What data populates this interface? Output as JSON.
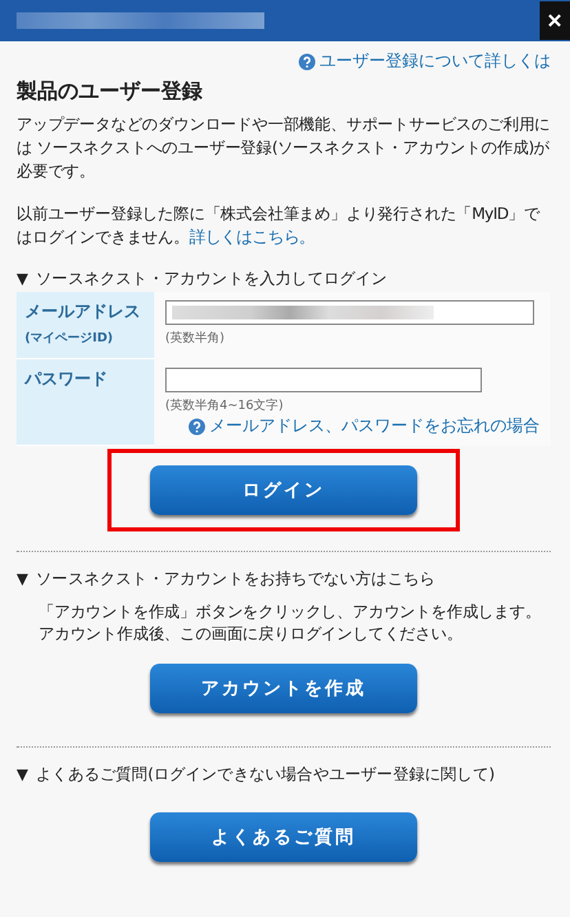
{
  "window": {
    "title_redacted": true,
    "close": "✕"
  },
  "help_link": "ユーザー登録について詳しくは",
  "heading": "製品のユーザー登録",
  "intro": "アップデータなどのダウンロードや一部機能、サポートサービスのご利用には ソースネクストへのユーザー登録(ソースネクスト・アカウントの作成)が必要です。",
  "notice": {
    "text": "以前ユーザー登録した際に「株式会社筆まめ」より発行された「MyID」ではログインできません。",
    "link": "詳しくはこちら。"
  },
  "login_section": {
    "marker": "▼",
    "title": "ソースネクスト・アカウントを入力してログイン",
    "fields": [
      {
        "label": "メールアドレス",
        "sublabel": "(マイページID)",
        "value_redacted": true,
        "hint": "(英数半角)",
        "wide": true
      },
      {
        "label": "パスワード",
        "hint": "(英数半角4~16文字)",
        "wide": false
      }
    ],
    "forgot_link": "メールアドレス、パスワードをお忘れの場合",
    "button": "ログイン",
    "highlighted": true
  },
  "create_section": {
    "marker": "▼",
    "title": "ソースネクスト・アカウントをお持ちでない方はこちら",
    "lines": [
      "「アカウントを作成」ボタンをクリックし、アカウントを作成します。",
      "アカウント作成後、この画面に戻りログインしてください。"
    ],
    "button": "アカウントを作成"
  },
  "faq_section": {
    "marker": "▼",
    "title": "よくあるご質問(ログインできない場合やユーザー登録に関して)",
    "button": "よくあるご質問"
  }
}
